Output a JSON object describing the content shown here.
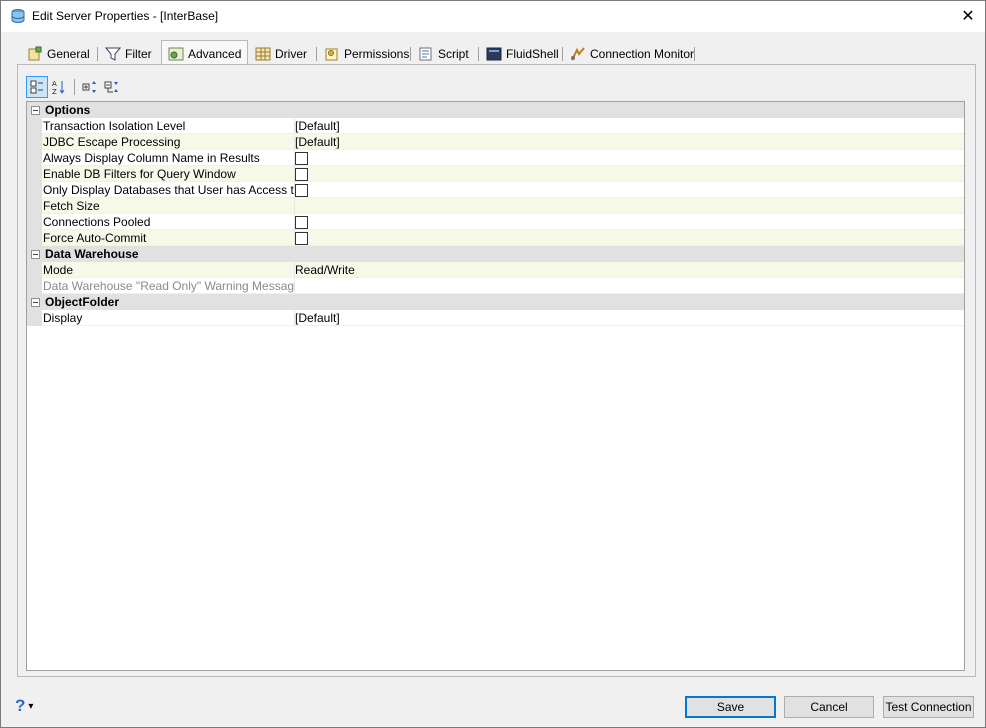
{
  "window": {
    "title": "Edit Server Properties - [InterBase]",
    "close_glyph": "✕"
  },
  "tabs": [
    {
      "label": "General",
      "icon": "general-icon"
    },
    {
      "label": "Filter",
      "icon": "filter-icon"
    },
    {
      "label": "Advanced",
      "icon": "advanced-icon",
      "active": true
    },
    {
      "label": "Driver",
      "icon": "driver-icon"
    },
    {
      "label": "Permissions",
      "icon": "permissions-icon"
    },
    {
      "label": "Script",
      "icon": "script-icon"
    },
    {
      "label": "FluidShell",
      "icon": "fluidshell-icon"
    },
    {
      "label": "Connection Monitor",
      "icon": "connection-monitor-icon"
    }
  ],
  "toolbar": {
    "buttons": [
      "categorized-icon",
      "alphabetical-sort-icon",
      "expand-all-icon",
      "collapse-all-icon"
    ]
  },
  "grid": {
    "categories": [
      {
        "name": "Options",
        "rows": [
          {
            "name": "Transaction Isolation Level",
            "value": "[Default]"
          },
          {
            "name": "JDBC Escape Processing",
            "value": "[Default]"
          },
          {
            "name": "Always Display Column Name in Results",
            "checkbox": true
          },
          {
            "name": "Enable DB Filters for Query Window",
            "checkbox": true
          },
          {
            "name": "Only Display Databases that User has Access to",
            "checkbox": true
          },
          {
            "name": "Fetch Size",
            "value": ""
          },
          {
            "name": "Connections Pooled",
            "checkbox": true
          },
          {
            "name": "Force Auto-Commit",
            "checkbox": true
          }
        ]
      },
      {
        "name": "Data Warehouse",
        "rows": [
          {
            "name": "Mode",
            "value": "Read/Write"
          },
          {
            "name": "Data Warehouse \"Read Only\" Warning Message",
            "value": "",
            "disabled": true
          }
        ]
      },
      {
        "name": "ObjectFolder",
        "rows": [
          {
            "name": "Display",
            "value": "[Default]"
          }
        ]
      }
    ]
  },
  "footer": {
    "help_glyph": "?",
    "help_dropdown_glyph": "▾",
    "save_label": "Save",
    "cancel_label": "Cancel",
    "test_label": "Test Connection"
  },
  "colors": {
    "accent": "#0078d7",
    "category_bg": "#e1e1e1",
    "alt_row_bg": "#f8f8e8"
  }
}
